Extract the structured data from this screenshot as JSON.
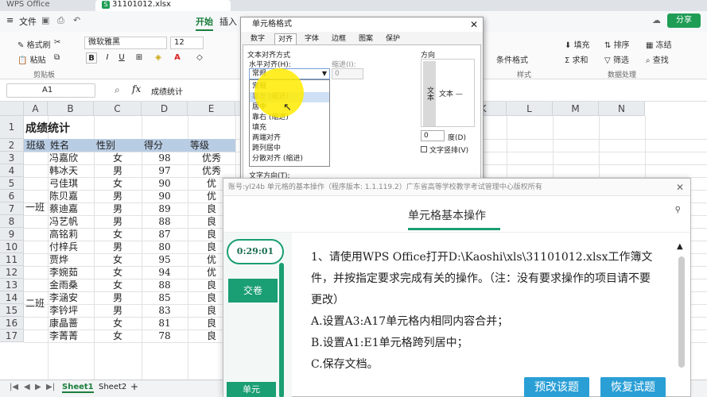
{
  "titlebar": {
    "home": "WPS Office",
    "file": "31101012.xlsx"
  },
  "menubar": {
    "file": "文件",
    "start": "开始",
    "insert": "插入",
    "share": "分享"
  },
  "ribbon": {
    "format_painter": "格式刷",
    "paste": "粘贴",
    "clipboard": "剪贴板",
    "font_name": "微软雅黑",
    "font_size": "12",
    "bold": "B",
    "fill": "填充",
    "sort": "排序",
    "freeze": "冻结",
    "sum": "求和",
    "filter": "筛选",
    "find": "查找",
    "cond_format": "条件格式",
    "styles": "样式",
    "data_proc": "数据处理"
  },
  "formula": {
    "cellref": "A1",
    "fx": "fx",
    "content": "成绩统计"
  },
  "grid": {
    "columns": [
      "A",
      "B",
      "C",
      "D",
      "E",
      "F",
      "G",
      "H",
      "I",
      "J",
      "K",
      "L",
      "M",
      "N"
    ],
    "rows": [
      "1",
      "2",
      "3",
      "4",
      "5",
      "6",
      "7",
      "8",
      "9",
      "10",
      "11",
      "12",
      "13",
      "14",
      "15",
      "16",
      "17"
    ],
    "title": "成绩统计",
    "headers": [
      "班级",
      "姓名",
      "性别",
      "得分",
      "等级"
    ],
    "class1": "一班",
    "class2": "二班",
    "students": [
      [
        "冯嘉欣",
        "女",
        "98",
        "优秀"
      ],
      [
        "韩冰天",
        "男",
        "97",
        "优秀"
      ],
      [
        "弓佳琪",
        "女",
        "90",
        "优"
      ],
      [
        "陈贝嘉",
        "男",
        "90",
        "优"
      ],
      [
        "蔡迪嘉",
        "男",
        "89",
        "良"
      ],
      [
        "冯艺帆",
        "男",
        "88",
        "良"
      ],
      [
        "高铭莉",
        "女",
        "87",
        "良"
      ],
      [
        "付梓兵",
        "男",
        "80",
        "良"
      ],
      [
        "贾烨",
        "女",
        "95",
        "优"
      ],
      [
        "李婉茹",
        "女",
        "94",
        "优"
      ],
      [
        "金雨桑",
        "女",
        "88",
        "良"
      ],
      [
        "李涵安",
        "男",
        "85",
        "良"
      ],
      [
        "李钤坪",
        "男",
        "83",
        "良"
      ],
      [
        "康晶蔷",
        "女",
        "81",
        "良"
      ],
      [
        "李菁菁",
        "女",
        "78",
        "良"
      ]
    ]
  },
  "sheets": [
    "Sheet1",
    "Sheet2"
  ],
  "dialog": {
    "title": "单元格格式",
    "tabs": [
      "数字",
      "对齐",
      "字体",
      "边框",
      "图案",
      "保护"
    ],
    "align_section": "文本对齐方式",
    "h_align": "水平对齐(H):",
    "indent": "缩进(I):",
    "indent_value": "0",
    "selected": "常规",
    "options": [
      "常规",
      "靠左 (缩进)",
      "居中",
      "靠右 (缩进)",
      "填充",
      "两端对齐",
      "跨列居中",
      "分散对齐 (缩进)"
    ],
    "orientation": "方向",
    "vertical_text": "文本",
    "horizontal_text": "文本 —",
    "degrees_value": "0",
    "degrees_label": "度(D)",
    "rotate_label": "文字竖排(V)",
    "text_dir": "文字方向(T):"
  },
  "exam": {
    "topline": "账号:yl24b   单元格的基本操作（程序版本: 1.1.119.2）广东省高等学校教学考试管理中心版权所有",
    "title": "单元格基本操作",
    "timer": "0:29:01",
    "submit": "交卷",
    "side": "单元",
    "question": [
      "1、请使用WPS Office打开D:\\Kaoshi\\xls\\31101012.xlsx工作簿文件，并按指定要求完成有关的操作。（注：没有要求操作的项目请不要更改）",
      "A.设置A3:A17单元格内相同内容合并；",
      "B.设置A1:E1单元格跨列居中；",
      "C.保存文档。"
    ],
    "reset_btn": "预改该题",
    "restore_btn": "恢复试题"
  }
}
